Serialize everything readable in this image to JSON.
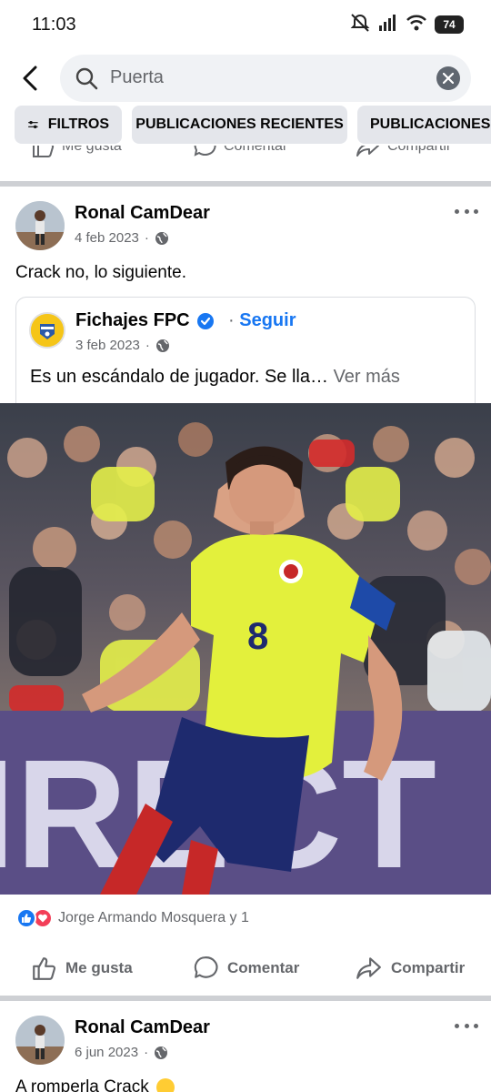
{
  "status": {
    "time": "11:03",
    "battery": "74"
  },
  "search": {
    "query": "Puerta"
  },
  "chips": {
    "filters": "FILTROS",
    "recent": "PUBLICACIONES RECIENTES",
    "third": "PUBLICACIONES C"
  },
  "actions": {
    "like": "Me gusta",
    "comment": "Comentar",
    "share": "Compartir"
  },
  "post1": {
    "author": "Ronal CamDear",
    "date": "4 feb 2023",
    "text": "Crack no, lo siguiente.",
    "shared": {
      "page": "Fichajes FPC",
      "follow": "Seguir",
      "date": "3 feb 2023",
      "text": "Es un escándalo de jugador. Se lla…",
      "see_more": "Ver más"
    },
    "photo": {
      "jersey_number": "8",
      "banner_text": "IRECT"
    },
    "reactions": "Jorge Armando Mosquera y 1"
  },
  "post2": {
    "author": "Ronal CamDear",
    "date": "6 jun 2023",
    "text": "A romperla Crack"
  },
  "colors": {
    "link_blue": "#1877f2",
    "jersey_yellow": "#e3f03c",
    "shorts_navy": "#1e2a6e",
    "love_red": "#f33e58"
  },
  "icons": [
    "signal-muted-icon",
    "cellular-icon",
    "wifi-icon",
    "search-icon",
    "clear-icon",
    "back-arrow-icon",
    "filter-sliders-icon",
    "globe-icon",
    "verified-badge-icon",
    "more-options-icon",
    "like-icon",
    "comment-icon",
    "share-icon",
    "like-reaction-icon",
    "love-reaction-icon",
    "fist-emoji-icon"
  ]
}
